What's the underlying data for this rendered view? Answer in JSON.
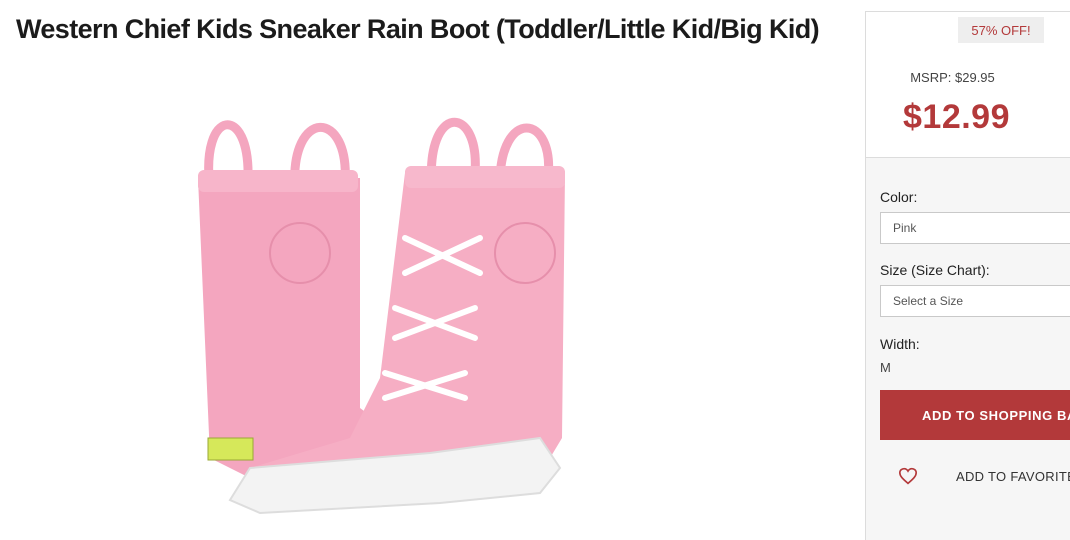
{
  "product": {
    "title": "Western Chief Kids Sneaker Rain Boot (Toddler/Little Kid/Big Kid)",
    "image_alt": "Pink rain boots with white laces"
  },
  "pricing": {
    "discount": "57% OFF!",
    "msrp": "MSRP: $29.95",
    "price": "$12.99"
  },
  "options": {
    "color_label": "Color:",
    "color_value": "Pink",
    "size_label": "Size (Size Chart):",
    "size_placeholder": "Select a Size",
    "width_label": "Width:",
    "width_value": "M"
  },
  "actions": {
    "add_to_bag": "ADD TO SHOPPING BAG",
    "add_to_favorites": "ADD TO FAVORITES ›"
  },
  "colors": {
    "accent": "#b3393a",
    "boot_pink": "#f4a6bf",
    "lace": "#ffffff"
  },
  "icons": {
    "favorite": "heart-icon"
  }
}
